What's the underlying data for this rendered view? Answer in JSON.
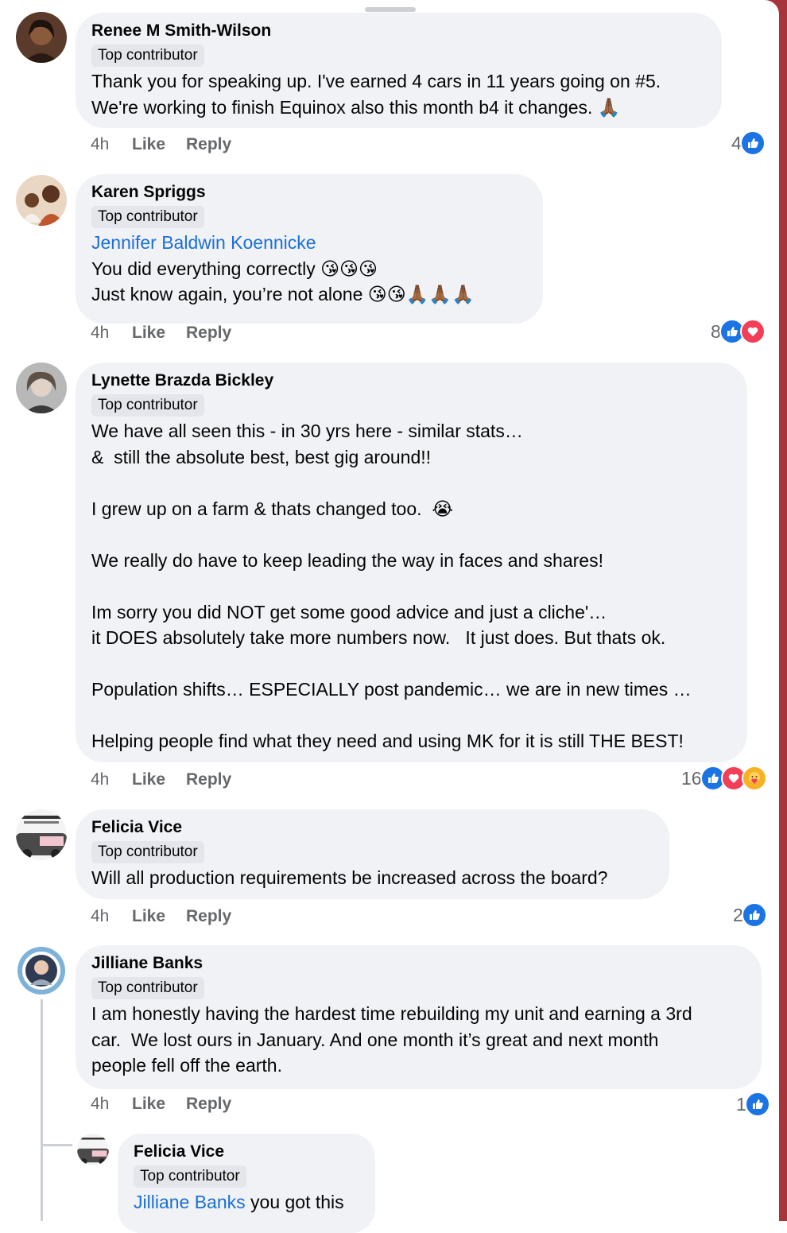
{
  "colors": {
    "accent": "#1b74e4",
    "mention": "#1b6fd6",
    "bubble": "#f0f2f5",
    "love": "#f33e58"
  },
  "labels": {
    "like": "Like",
    "reply": "Reply"
  },
  "comments": [
    {
      "author": "Renee M Smith-Wilson",
      "badge": "Top contributor",
      "lines": [
        "Thank you for speaking up. I've earned 4 cars in 11 years going on #5.",
        "We're working to finish Equinox also this month b4 it changes. 🙏🏾"
      ],
      "time": "4h",
      "reaction_count": "4",
      "reactions": [
        "like-icon"
      ]
    },
    {
      "author": "Karen Spriggs",
      "badge": "Top contributor",
      "mention": "Jennifer Baldwin Koennicke",
      "lines": [
        "You did everything correctly 😘😘😘",
        "Just know again, you’re not alone 😘😘🙏🏾🙏🏾🙏🏾"
      ],
      "time": "4h",
      "reaction_count": "8",
      "reactions": [
        "like-icon",
        "love-icon"
      ]
    },
    {
      "author": "Lynette Brazda Bickley",
      "badge": "Top contributor",
      "lines": [
        "We have all seen this - in 30 yrs here - similar stats…",
        "&  still the absolute best, best gig around!!",
        "",
        "I grew up on a farm & thats changed too.  😭",
        "",
        "We really do have to keep leading the way in faces and shares!",
        "",
        "Im sorry you did NOT get some good advice and just a cliche'…",
        "it DOES absolutely take more numbers now.   It just does. But thats ok.",
        "",
        "Population shifts… ESPECIALLY post pandemic… we are in new times …",
        "",
        "Helping people find what they need and using MK for it is still THE BEST!"
      ],
      "time": "4h",
      "reaction_count": "16",
      "reactions": [
        "like-icon",
        "love-icon",
        "care-icon"
      ]
    },
    {
      "author": "Felicia Vice",
      "badge": "Top contributor",
      "lines": [
        "Will all production requirements be increased across the board?"
      ],
      "time": "4h",
      "reaction_count": "2",
      "reactions": [
        "like-icon"
      ]
    },
    {
      "author": "Jilliane Banks",
      "badge": "Top contributor",
      "lines": [
        "I am honestly having the hardest time rebuilding my unit and earning a 3rd",
        "car.  We lost ours in January. And one month it’s great and next month",
        "people fell off the earth."
      ],
      "time": "4h",
      "reaction_count": "1",
      "reactions": [
        "like-icon"
      ]
    }
  ],
  "reply": {
    "author": "Felicia Vice",
    "badge": "Top contributor",
    "mention": "Jilliane Banks",
    "text": " you got this"
  }
}
